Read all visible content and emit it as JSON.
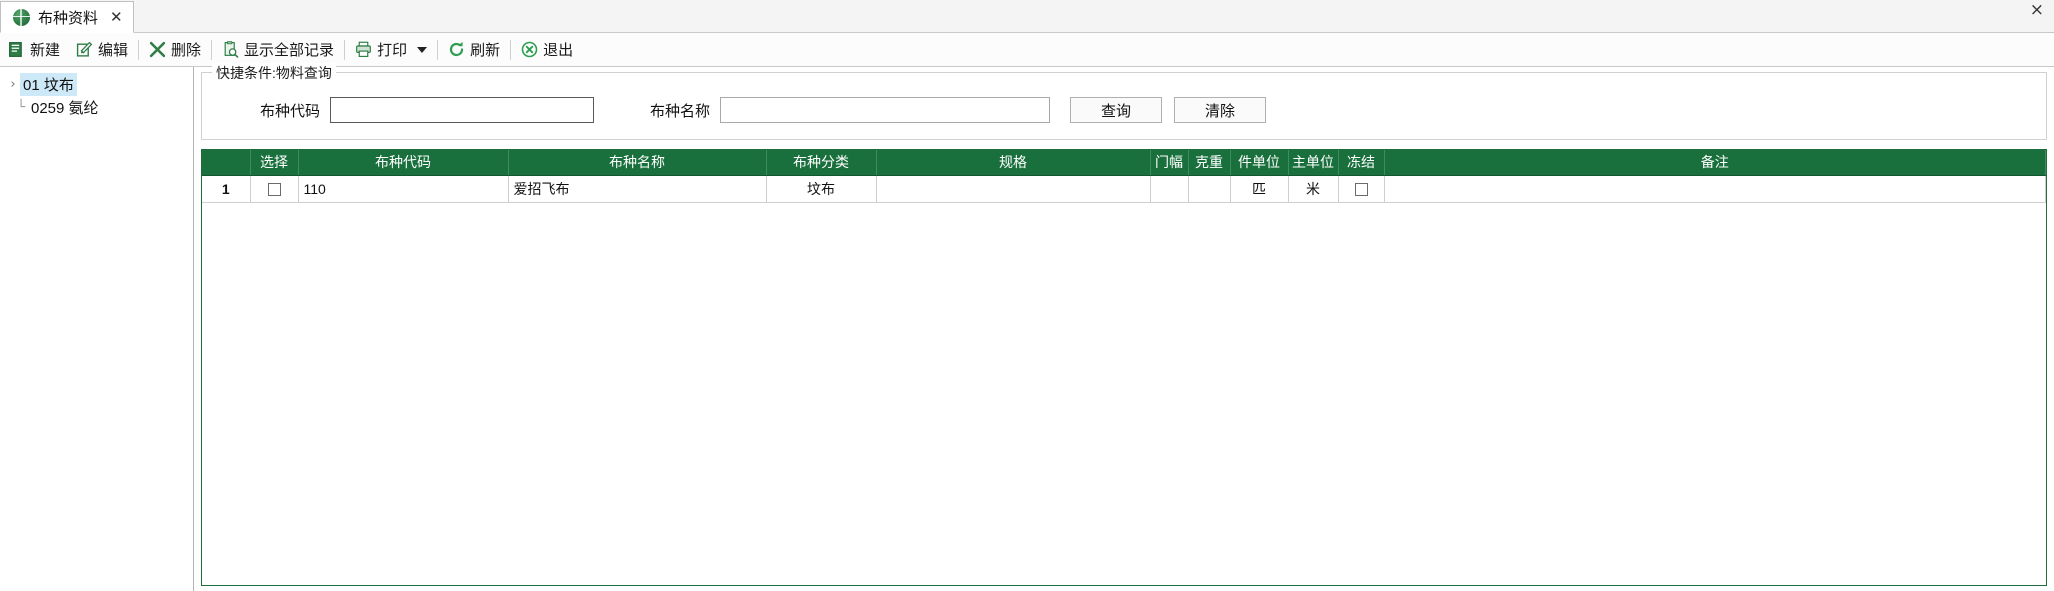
{
  "window": {
    "close_label": "×"
  },
  "tab": {
    "title": "布种资料",
    "close_label": "✕",
    "icon": "globe-icon"
  },
  "toolbar": {
    "items": [
      {
        "label": "新建",
        "icon": "new-document-icon",
        "has_caret": false
      },
      {
        "label": "编辑",
        "icon": "edit-pencil-icon",
        "has_caret": false
      },
      {
        "label": "删除",
        "icon": "delete-x-icon",
        "has_caret": false
      },
      {
        "label": "显示全部记录",
        "icon": "search-records-icon",
        "has_caret": false
      },
      {
        "label": "打印",
        "icon": "printer-icon",
        "has_caret": true
      },
      {
        "label": "刷新",
        "icon": "refresh-icon",
        "has_caret": false
      },
      {
        "label": "退出",
        "icon": "exit-circle-x-icon",
        "has_caret": false
      }
    ]
  },
  "tree": {
    "items": [
      {
        "label": "01 坟布",
        "selected": true,
        "expander": "›"
      },
      {
        "label": "0259 氨纶",
        "selected": false,
        "expander": "└"
      }
    ]
  },
  "query_panel": {
    "title": "快捷条件:物料查询",
    "fields": [
      {
        "label": "布种代码",
        "value": "",
        "placeholder": ""
      },
      {
        "label": "布种名称",
        "value": "",
        "placeholder": ""
      }
    ],
    "buttons": [
      {
        "label": "查询"
      },
      {
        "label": "清除"
      }
    ]
  },
  "grid": {
    "columns": [
      {
        "label": "",
        "key": "rownum"
      },
      {
        "label": "选择",
        "key": "select"
      },
      {
        "label": "布种代码",
        "key": "code"
      },
      {
        "label": "布种名称",
        "key": "name"
      },
      {
        "label": "布种分类",
        "key": "category"
      },
      {
        "label": "规格",
        "key": "spec"
      },
      {
        "label": "门幅",
        "key": "width"
      },
      {
        "label": "克重",
        "key": "weight"
      },
      {
        "label": "件单位",
        "key": "pkg_unit"
      },
      {
        "label": "主单位",
        "key": "main_unit"
      },
      {
        "label": "冻结",
        "key": "frozen"
      },
      {
        "label": "备注",
        "key": "remark"
      }
    ],
    "rows": [
      {
        "rownum": "1",
        "select": "",
        "code": "110",
        "name": "爱招飞布",
        "category": "坟布",
        "spec": "",
        "width": "",
        "weight": "",
        "pkg_unit": "匹",
        "main_unit": "米",
        "frozen": "",
        "remark": ""
      }
    ]
  },
  "colors": {
    "header_green": "#19703d",
    "selection_blue": "#cde8f6",
    "rownum_red": "#c0392b",
    "category_tint": "#eef7f0"
  }
}
